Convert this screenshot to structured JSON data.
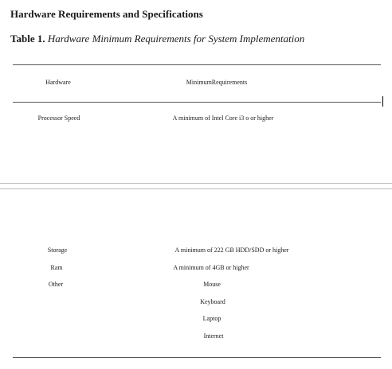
{
  "document": {
    "heading": "Hardware Requirements and Specifications",
    "caption_number": "Table 1.",
    "caption_title": "Hardware Minimum Requirements for System Implementation"
  },
  "table": {
    "headers": [
      "Hardware",
      "MinimumRequirements"
    ],
    "rows": [
      {
        "hardware": "Processor Speed",
        "requirement": "A minimum of Intel Core i3 o or higher"
      },
      {
        "hardware": "Storage",
        "requirement": "A minimum of 222 GB HDD/SDD or higher"
      },
      {
        "hardware": "Ram",
        "requirement": "A minimum of 4GB or higher"
      },
      {
        "hardware": "Other",
        "requirement": "Mouse"
      },
      {
        "hardware": "",
        "requirement": "Keyboard"
      },
      {
        "hardware": "",
        "requirement": "Laptop"
      },
      {
        "hardware": "",
        "requirement": "Internet"
      }
    ]
  }
}
